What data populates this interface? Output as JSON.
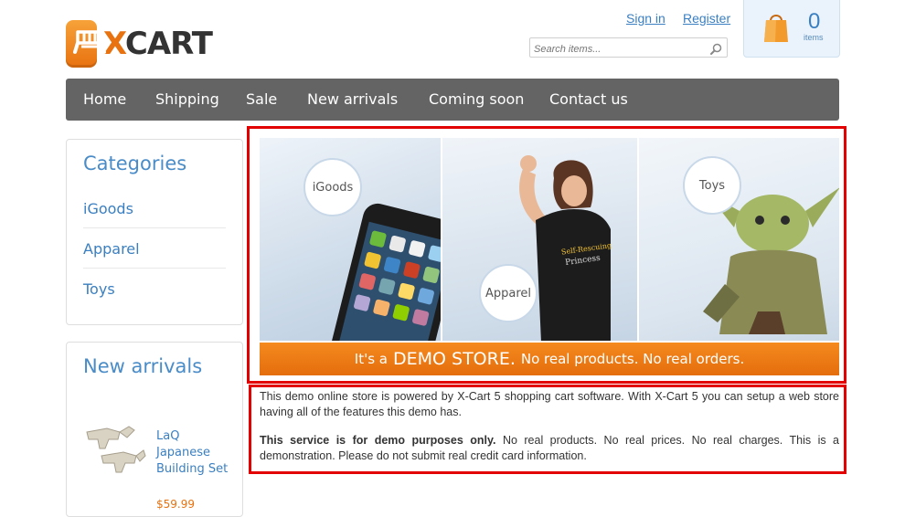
{
  "header": {
    "logo_x": "X",
    "logo_cart": "CART",
    "signin_label": "Sign in",
    "register_label": "Register",
    "search_placeholder": "Search items...",
    "cart_count": "0",
    "cart_items_label": "items"
  },
  "nav": {
    "items": [
      "Home",
      "Shipping",
      "Sale",
      "New arrivals",
      "Coming soon",
      "Contact us"
    ]
  },
  "sidebar": {
    "categories_title": "Categories",
    "categories": [
      "iGoods",
      "Apparel",
      "Toys"
    ],
    "new_arrivals_title": "New arrivals",
    "product_name": "LaQ Japanese Building Set",
    "product_price": "$59.99"
  },
  "banner": {
    "bubbles": [
      "iGoods",
      "Apparel",
      "Toys"
    ],
    "tagline_prefix": "It's a",
    "tagline_big": "DEMO STORE.",
    "tagline_suffix": "No real products. No real orders."
  },
  "description": {
    "para1": "This demo online store is powered by X-Cart 5 shopping cart software. With X-Cart 5 you can setup a web store having all of the features this demo has.",
    "para2_bold": "This service is for demo purposes only.",
    "para2_rest": " No real products. No real prices. No real charges. This is a demonstration. Please do not submit real credit card information."
  },
  "colors": {
    "brand_orange": "#e8720f",
    "link_blue": "#3a7fc1",
    "nav_bg": "#646464",
    "highlight_red": "#e30000"
  }
}
